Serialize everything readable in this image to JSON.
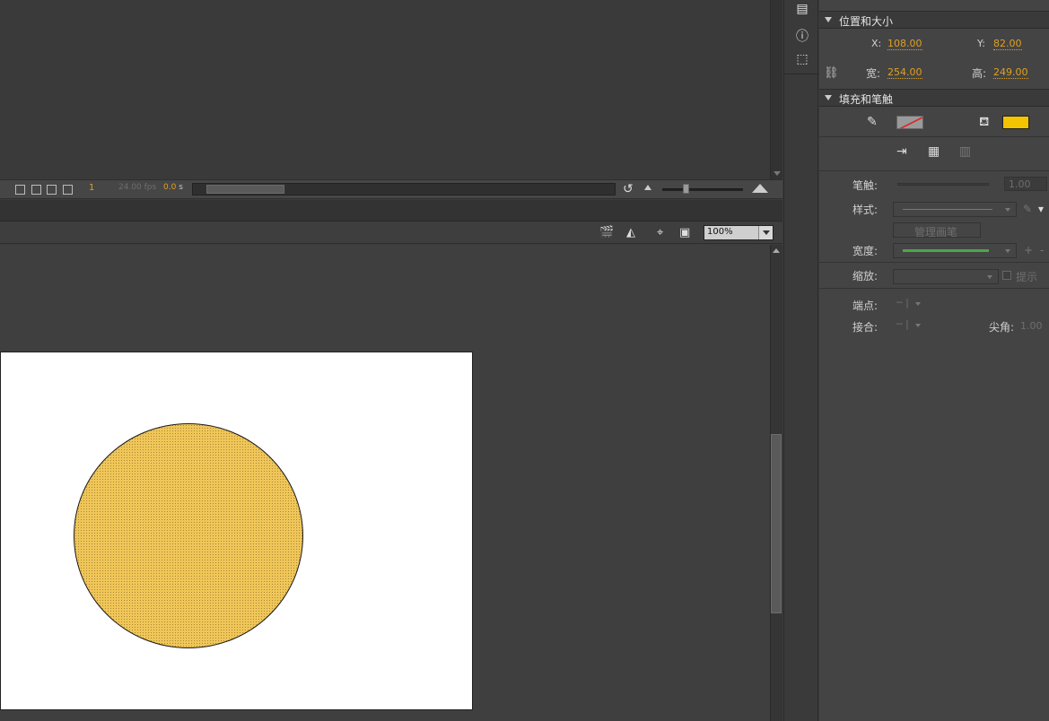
{
  "timeline": {
    "frame": "1",
    "fps": "24.00 fps",
    "time_value": "0.0",
    "time_unit": "s"
  },
  "stage": {
    "zoom": "100%",
    "shape_fill_color": "#f0c659"
  },
  "properties": {
    "position_size": {
      "title": "位置和大小",
      "x_label": "X:",
      "x_value": "108.00",
      "y_label": "Y:",
      "y_value": "82.00",
      "width_label": "宽:",
      "width_value": "254.00",
      "height_label": "高:",
      "height_value": "249.00"
    },
    "fill_stroke": {
      "title": "填充和笔触",
      "fill_color": "#f5c400",
      "stroke_label": "笔触:",
      "stroke_value": "1.00",
      "style_label": "样式:",
      "manage_brush_label": "管理画笔",
      "width_label": "宽度:",
      "scale_label": "缩放:",
      "hint_label": "提示",
      "cap_label": "端点:",
      "join_label": "接合:",
      "miter_label": "尖角:",
      "miter_value": "1.00"
    }
  },
  "icons": {
    "strip": [
      "align-icon",
      "info-icon",
      "transform-icon"
    ]
  }
}
